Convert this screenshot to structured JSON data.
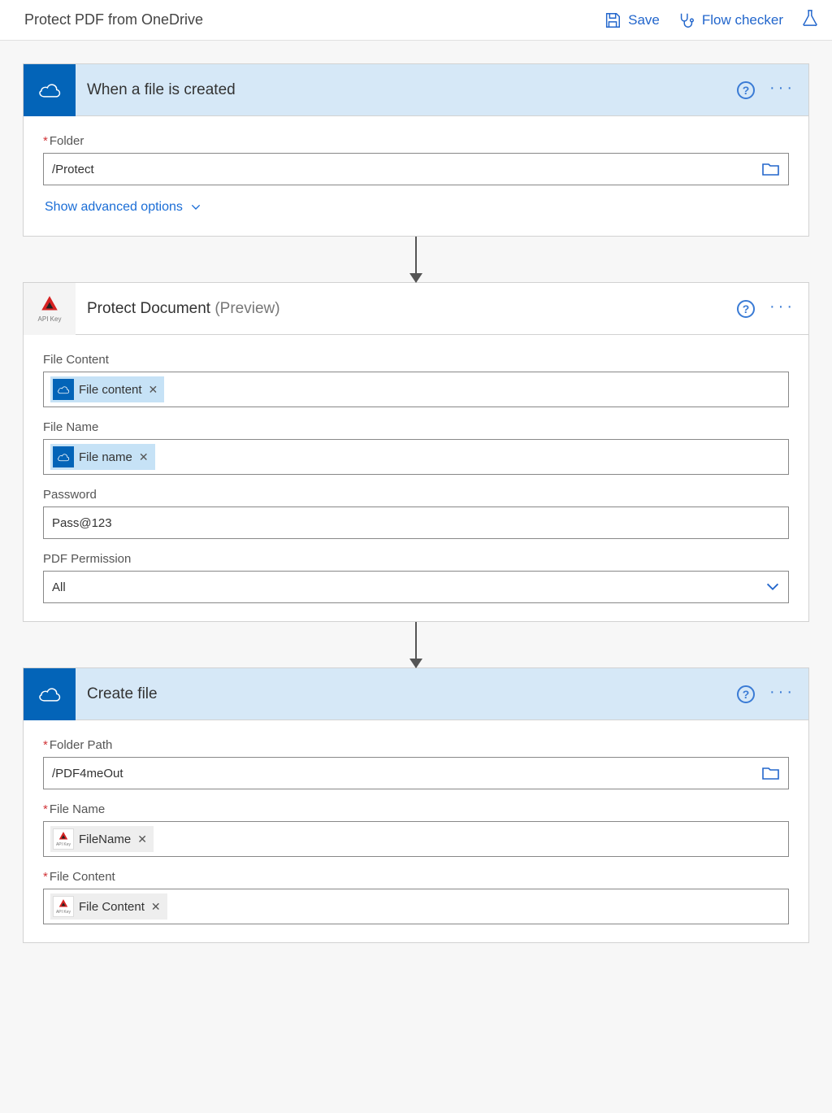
{
  "topbar": {
    "title": "Protect PDF from OneDrive",
    "save_label": "Save",
    "flowchecker_label": "Flow checker"
  },
  "step1": {
    "title": "When a file is created",
    "folder_label": "Folder",
    "folder_value": "/Protect",
    "advanced_label": "Show advanced options"
  },
  "step2": {
    "title": "Protect Document",
    "preview": " (Preview)",
    "fileContent_label": "File Content",
    "fileContent_chip": "File content",
    "fileName_label": "File Name",
    "fileName_chip": "File name",
    "password_label": "Password",
    "password_value": "Pass@123",
    "permission_label": "PDF Permission",
    "permission_value": "All",
    "apikey_label": "API Key"
  },
  "step3": {
    "title": "Create file",
    "folderPath_label": "Folder Path",
    "folderPath_value": "/PDF4meOut",
    "fileName_label": "File Name",
    "fileName_chip": "FileName",
    "fileContent_label": "File Content",
    "fileContent_chip": "File Content",
    "apikey_label": "API Key"
  }
}
